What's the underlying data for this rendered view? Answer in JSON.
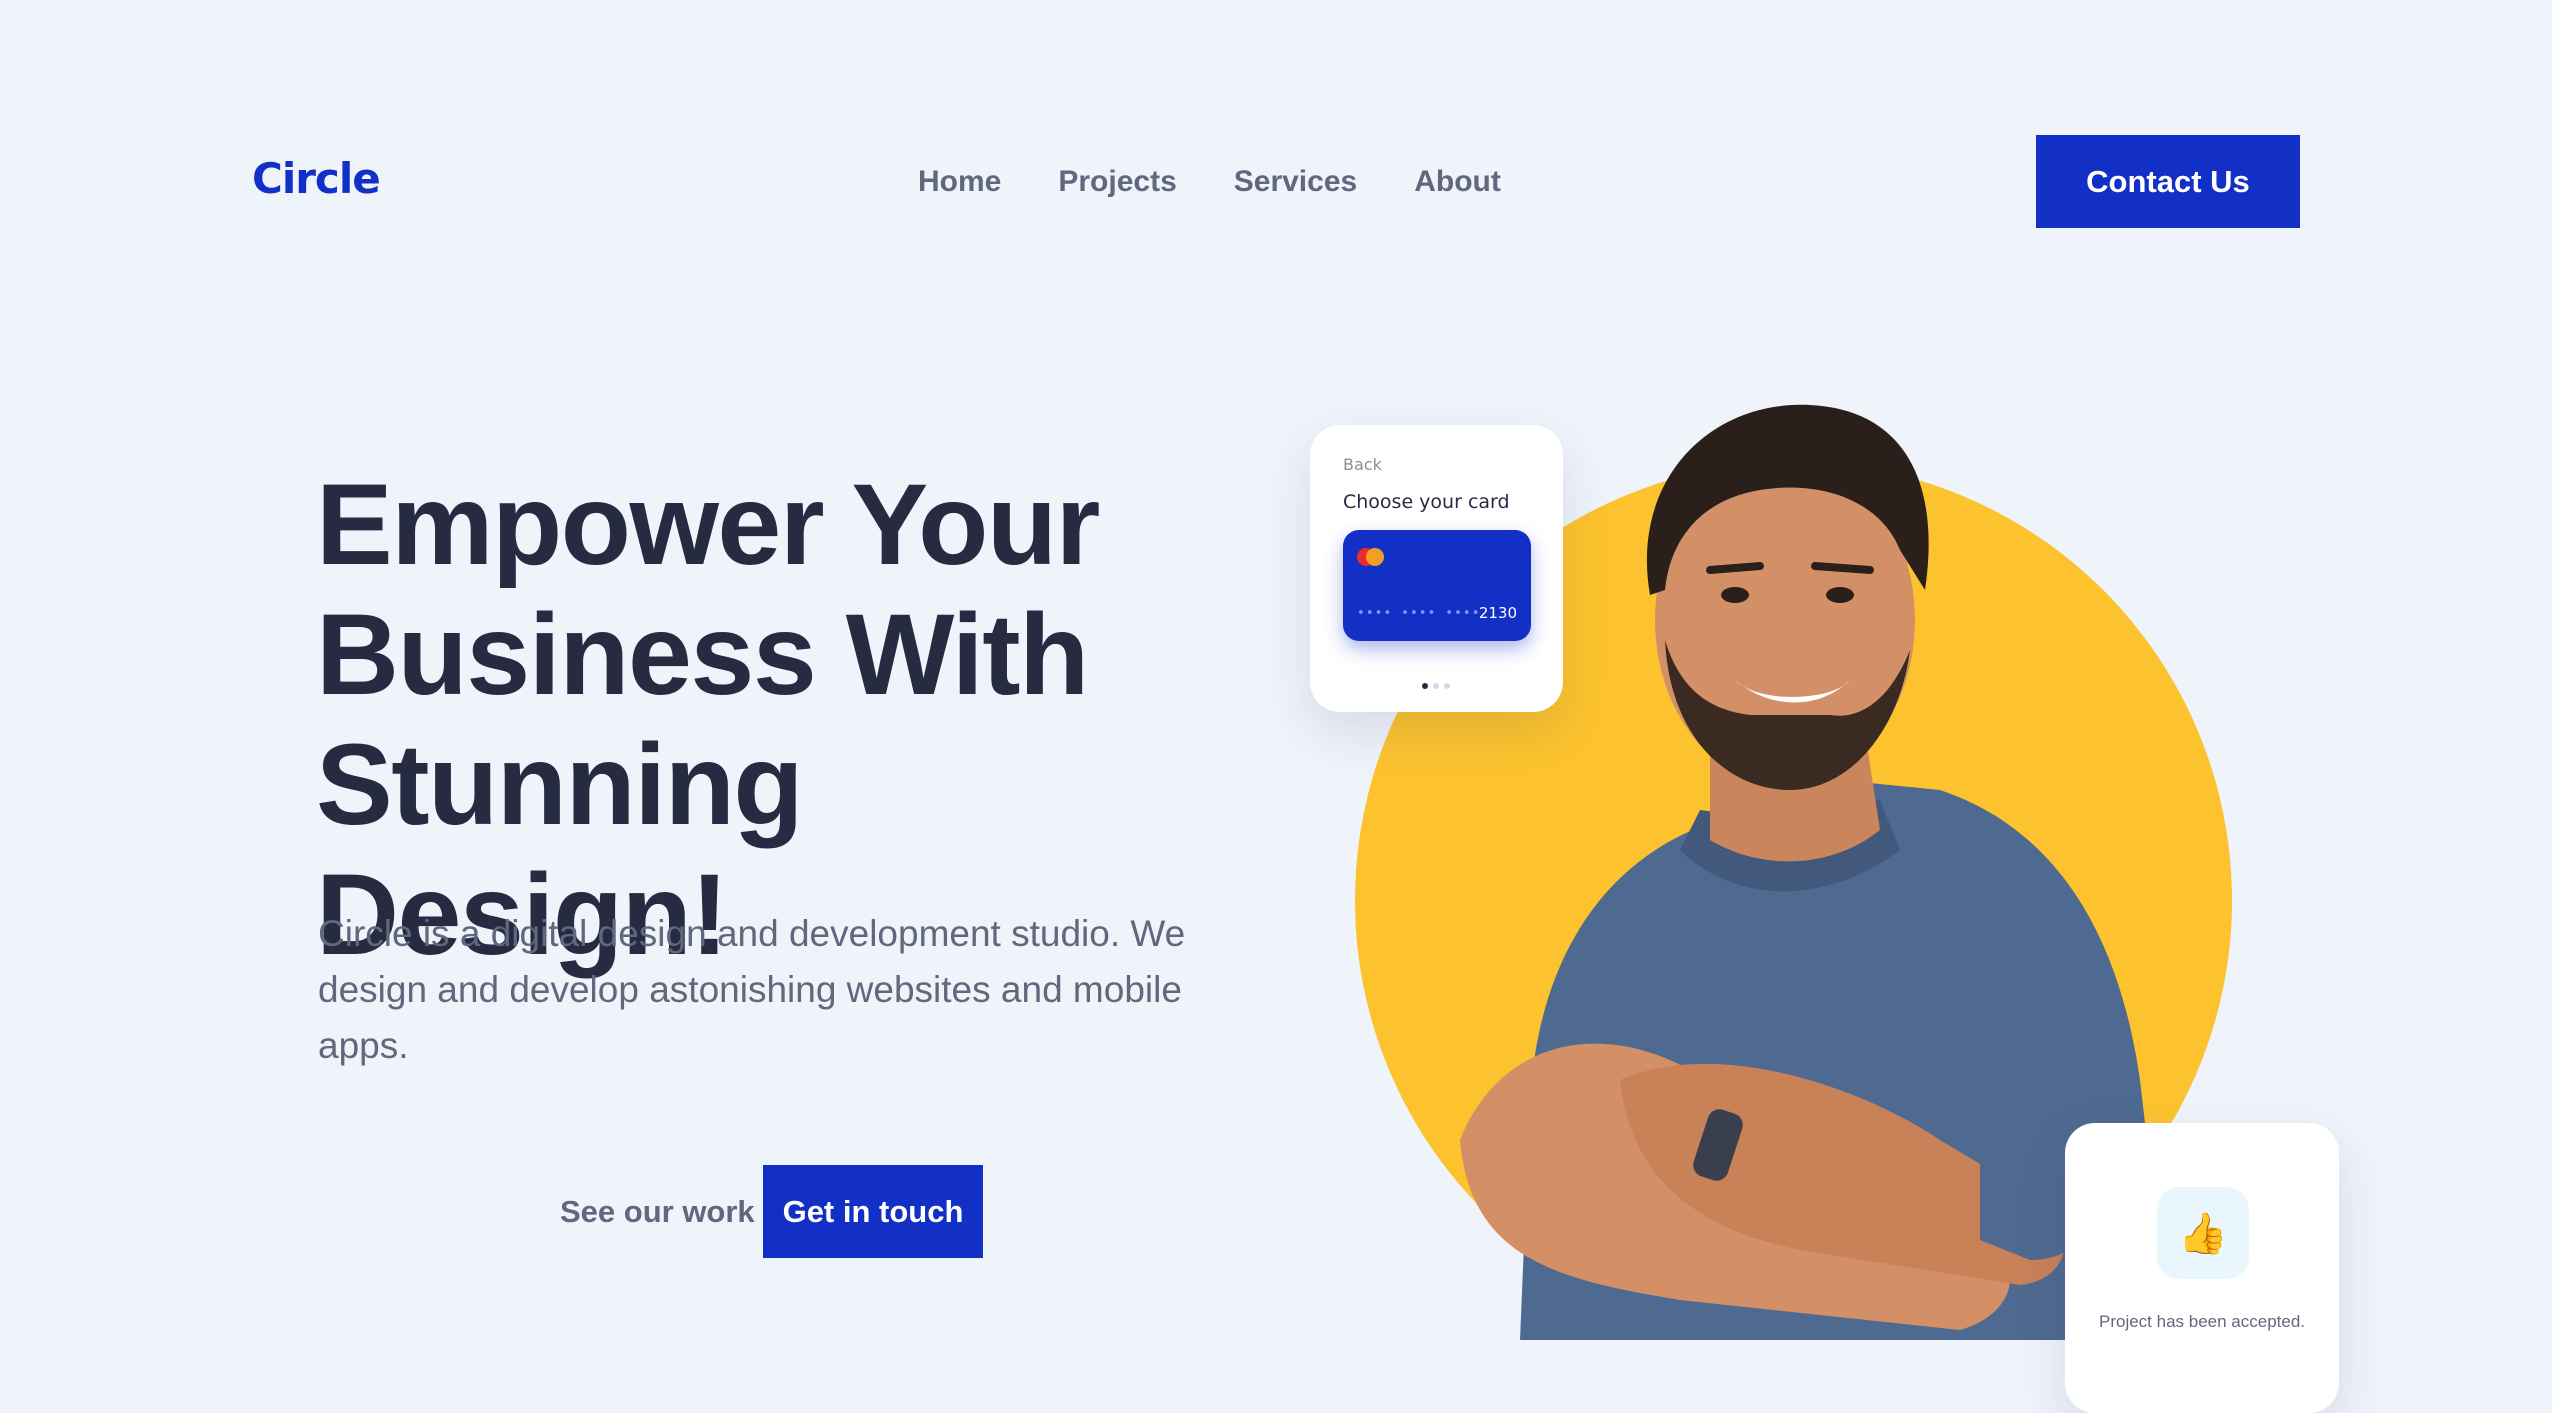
{
  "brand": {
    "logo_text": "Circle",
    "primary_color": "#1230c6",
    "accent_color": "#fcc32e",
    "background_color": "#eff3fa"
  },
  "nav": {
    "items": [
      {
        "label": "Home"
      },
      {
        "label": "Projects"
      },
      {
        "label": "Services"
      },
      {
        "label": "About"
      }
    ],
    "cta_label": "Contact Us"
  },
  "hero": {
    "headline_lines": [
      "Empower Your",
      "Business With",
      "Stunning Design!"
    ],
    "description": "Circle is a digital design and development studio. We design and develop astonishing websites and mobile apps.",
    "secondary_action": "See our work",
    "primary_action": "Get in touch"
  },
  "card_widget": {
    "back_label": "Back",
    "title": "Choose your card",
    "card_masked": "•••• •••• ••••",
    "card_last_digits": "2130",
    "pager_count": 3,
    "pager_active": 1
  },
  "accept_widget": {
    "icon": "thumbs-up-icon",
    "icon_glyph": "👍",
    "message": "Project has been accepted."
  }
}
